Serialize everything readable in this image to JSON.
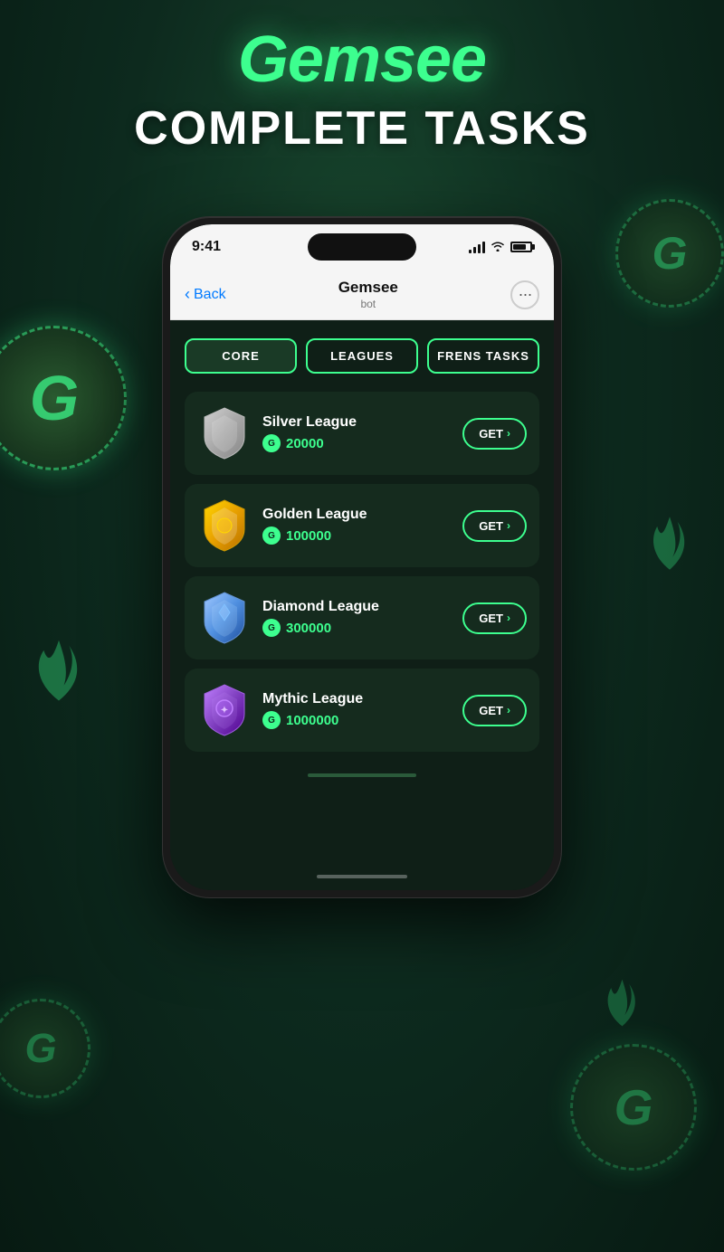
{
  "background": {
    "color": "#0d2a1e"
  },
  "header": {
    "logo": "Gemsee",
    "tagline": "COMPLETE TASKS"
  },
  "status_bar": {
    "time": "9:41",
    "signal": "signal",
    "wifi": "wifi",
    "battery": "battery"
  },
  "nav": {
    "back_label": "Back",
    "title": "Gemsee",
    "subtitle": "bot",
    "more_icon": "···"
  },
  "tabs": [
    {
      "label": "CORE",
      "active": true
    },
    {
      "label": "LEAGUES",
      "active": false
    },
    {
      "label": "FRENS TASKS",
      "active": false
    }
  ],
  "leagues": [
    {
      "name": "Silver League",
      "reward": "20000",
      "badge_type": "silver",
      "get_label": "GET",
      "arrow": "›"
    },
    {
      "name": "Golden League",
      "reward": "100000",
      "badge_type": "gold",
      "get_label": "GET",
      "arrow": "›"
    },
    {
      "name": "Diamond League",
      "reward": "300000",
      "badge_type": "diamond",
      "get_label": "GET",
      "arrow": "›"
    },
    {
      "name": "Mythic League",
      "reward": "1000000",
      "badge_type": "mythic",
      "get_label": "GET",
      "arrow": "›"
    }
  ],
  "gem_icon_label": "G",
  "accent_color": "#3dff8f"
}
